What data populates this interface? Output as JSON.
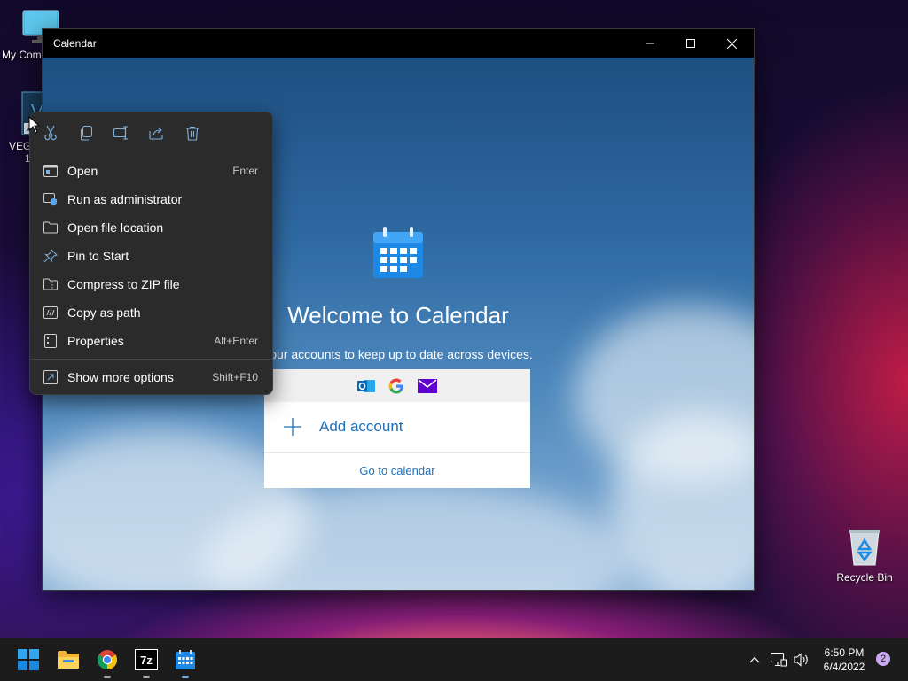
{
  "desktop": {
    "icons": [
      {
        "label": "My Com",
        "icon": "monitor-icon"
      },
      {
        "label": "VEG",
        "label2": "1",
        "icon": "vegas-shortcut-icon"
      },
      {
        "label": "Recycle Bin",
        "icon": "recycle-bin-icon"
      }
    ]
  },
  "calendar_window": {
    "title": "Calendar",
    "controls": {
      "minimize": "minimize-icon",
      "maximize": "maximize-icon",
      "close": "close-icon"
    },
    "welcome_title": "Welcome to Calendar",
    "welcome_subtitle": "your accounts to keep up to date across devices.",
    "providers": [
      "outlook-icon",
      "google-icon",
      "yahoo-mail-icon"
    ],
    "add_account_label": "Add account",
    "goto_calendar_label": "Go to calendar"
  },
  "context_menu": {
    "toolbar": [
      "cut-icon",
      "copy-icon",
      "rename-icon",
      "share-icon",
      "delete-icon"
    ],
    "items": [
      {
        "label": "Open",
        "shortcut": "Enter",
        "icon": "open-app-icon"
      },
      {
        "label": "Run as administrator",
        "shortcut": "",
        "icon": "shield-icon"
      },
      {
        "label": "Open file location",
        "shortcut": "",
        "icon": "folder-icon"
      },
      {
        "label": "Pin to Start",
        "shortcut": "",
        "icon": "pin-icon"
      },
      {
        "label": "Compress to ZIP file",
        "shortcut": "",
        "icon": "zip-folder-icon"
      },
      {
        "label": "Copy as path",
        "shortcut": "",
        "icon": "copy-path-icon"
      },
      {
        "label": "Properties",
        "shortcut": "Alt+Enter",
        "icon": "properties-icon"
      },
      {
        "label": "Show more options",
        "shortcut": "Shift+F10",
        "icon": "more-options-icon"
      }
    ]
  },
  "taskbar": {
    "apps": [
      "start-icon",
      "file-explorer-icon",
      "chrome-icon",
      "7zip-icon",
      "calendar-icon"
    ],
    "seven_zip_label": "7z",
    "tray": [
      "chevron-up-icon",
      "network-icon",
      "volume-icon"
    ],
    "clock_time": "6:50 PM",
    "clock_date": "6/4/2022",
    "notification_count": "2"
  },
  "colors": {
    "accent": "#1e6fb8",
    "menu_bg": "#2b2b2b",
    "taskbar_bg": "#1c1c1c"
  }
}
